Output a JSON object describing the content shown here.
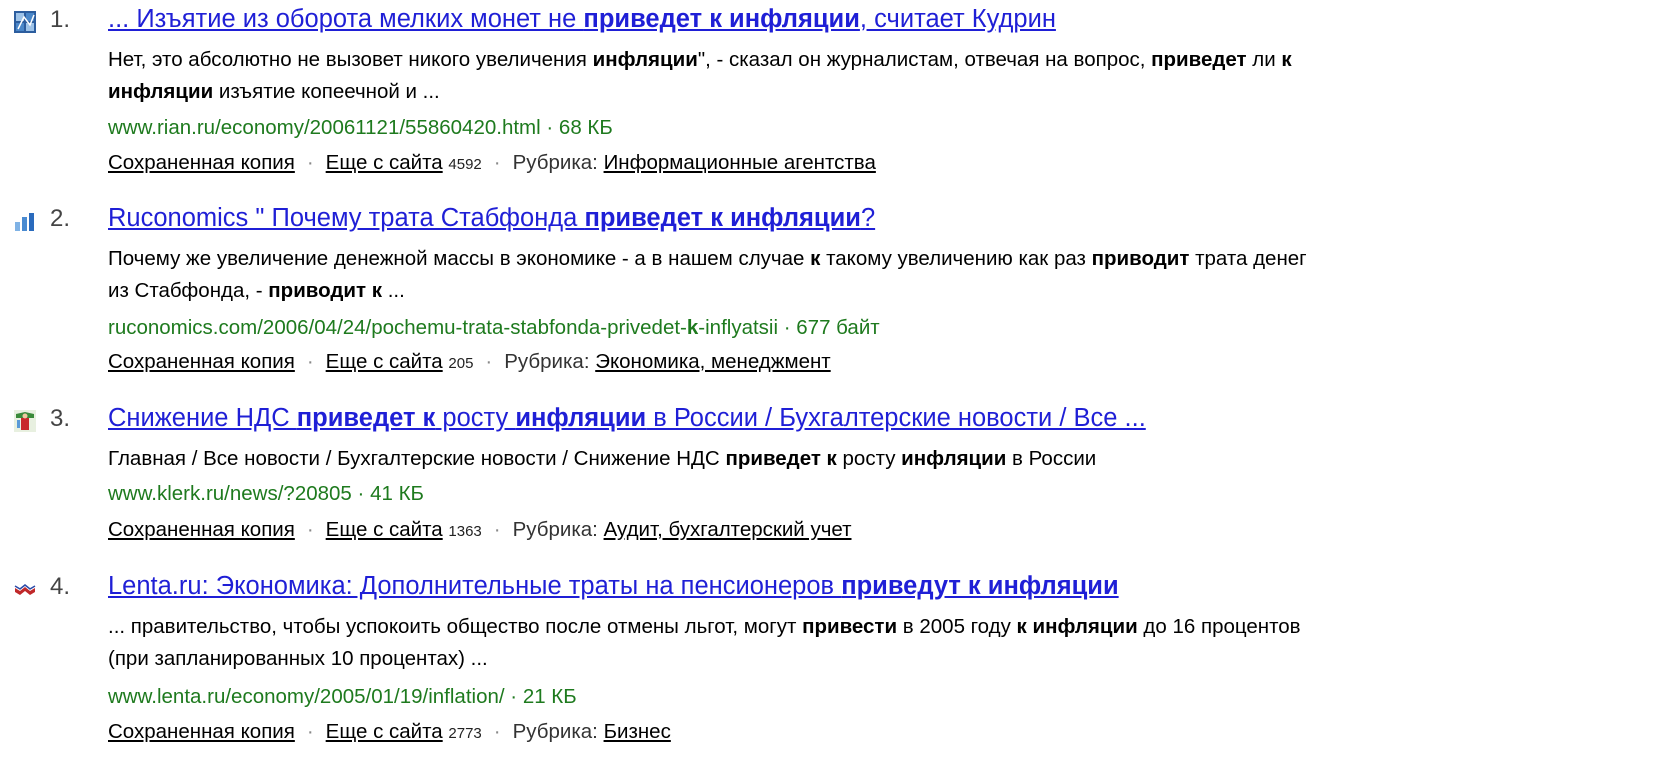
{
  "results": [
    {
      "number": "1.",
      "favicon": "rian-icon",
      "title": [
        "... Изъятие из оборота мелких монет не ",
        "приведет к инфляции",
        ", считает Кудрин"
      ],
      "snippet": [
        [
          "Нет, это абсолютно не вызовет никого увеличения ",
          "инфляции",
          "\", - сказал он журналистам, отвечая на вопрос, ",
          "приведет",
          " ли ",
          "к",
          ""
        ],
        [
          "",
          "инфляции",
          " изъятие копеечной и ..."
        ]
      ],
      "url": "www.rian.ru/economy/20061121/55860420.html",
      "size": "68 КБ",
      "cached_label": "Сохраненная копия",
      "more_label": "Еще с сайта",
      "more_count": "4592",
      "rubric_label": "Рубрика:",
      "rubric": "Информационные агентства"
    },
    {
      "number": "2.",
      "favicon": "bar-chart-icon",
      "title": [
        "Ruconomics \" Почему трата Стабфонда ",
        "приведет к инфляции",
        "?"
      ],
      "snippet": [
        [
          "Почему же увеличение денежной массы в экономике - а в нашем случае ",
          "к",
          " такому увеличению как раз ",
          "приводит",
          " трата денег"
        ],
        [
          "из Стабфонда, - ",
          "приводит к",
          " ..."
        ]
      ],
      "url": [
        "ruconomics.com/2006/04/24/pochemu-trata-stabfonda-privedet-",
        "k",
        "-inflyatsii"
      ],
      "size": "677 байт",
      "cached_label": "Сохраненная копия",
      "more_label": "Еще с сайта",
      "more_count": "205",
      "rubric_label": "Рубрика:",
      "rubric": "Экономика, менеджмент"
    },
    {
      "number": "3.",
      "favicon": "klerk-icon",
      "title": [
        "Снижение НДС ",
        "приведет к",
        " росту ",
        "инфляции",
        " в России / Бухгалтерские новости / Все ..."
      ],
      "snippet": [
        [
          "Главная / Все новости / Бухгалтерские новости / Снижение НДС ",
          "приведет к",
          " росту ",
          "инфляции",
          " в России"
        ]
      ],
      "url": "www.klerk.ru/news/?20805",
      "size": "41 КБ",
      "cached_label": "Сохраненная копия",
      "more_label": "Еще с сайта",
      "more_count": "1363",
      "rubric_label": "Рубрика:",
      "rubric": "Аудит, бухгалтерский учет"
    },
    {
      "number": "4.",
      "favicon": "lenta-icon",
      "title": [
        "Lenta.ru: Экономика: Дополнительные траты на пенсионеров ",
        "приведут к инфляции",
        ""
      ],
      "snippet": [
        [
          "... правительство, чтобы успокоить общество после отмены льгот, могут ",
          "привести",
          " в 2005 году ",
          "к инфляции",
          " до 16 процентов"
        ],
        [
          "(при запланированных 10 процентах) ..."
        ]
      ],
      "url": "www.lenta.ru/economy/2005/01/19/inflation/",
      "size": "21 КБ",
      "cached_label": "Сохраненная копия",
      "more_label": "Еще с сайта",
      "more_count": "2773",
      "rubric_label": "Рубрика:",
      "rubric": "Бизнес"
    }
  ],
  "separator": "·",
  "colors": {
    "title": "#1f1fd6",
    "url": "#1e7a1e",
    "text": "#000000"
  }
}
